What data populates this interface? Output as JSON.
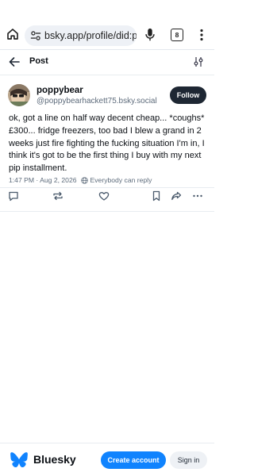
{
  "browser": {
    "url": "bsky.app/profile/did:plc:f",
    "tab_count": "8"
  },
  "header": {
    "title": "Post"
  },
  "post": {
    "display_name": "poppybear",
    "handle": "@poppybearhackett75.bsky.social",
    "follow_label": "Follow",
    "text": "ok, got a line on half way decent cheap... *coughs* £300... fridge freezers, too bad I blew a grand in 2 weeks just fire fighting the fucking situation I'm in, I think it's got to be the first thing I buy with my next pip installment.",
    "timestamp": "1:47 PM · Aug 2, 2026",
    "reply_setting": "Everybody can reply",
    "actions": [
      "reply-icon",
      "repost-icon",
      "like-icon",
      "bookmark-icon",
      "share-icon",
      "more-icon"
    ]
  },
  "footer": {
    "brand": "Bluesky",
    "create_account_label": "Create account",
    "sign_in_label": "Sign in"
  },
  "colors": {
    "brand_blue": "#1083fe",
    "follow_bg": "#1e2733",
    "muted_text": "#5d6b7b"
  }
}
